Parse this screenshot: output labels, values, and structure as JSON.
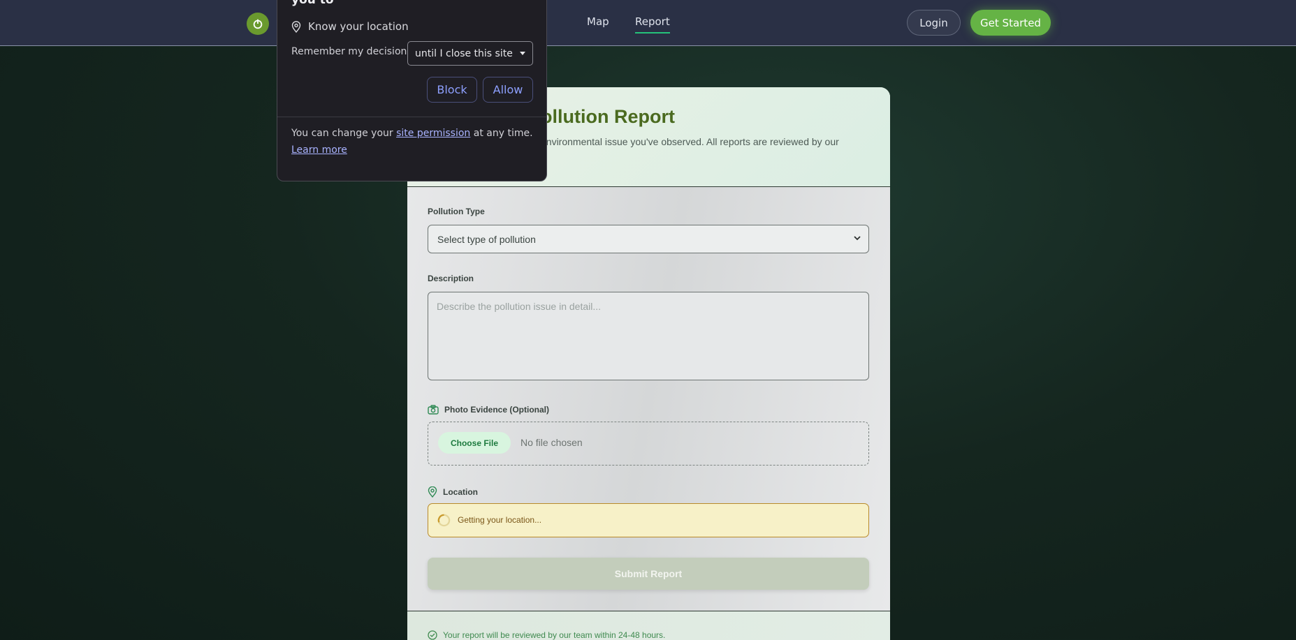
{
  "nav": {
    "links": [
      "Map",
      "Report"
    ],
    "login_label": "Login",
    "cta_label": "Get Started"
  },
  "report": {
    "title": "Pollution Report",
    "title_visible": "ollution Report",
    "subtitle_visible": "environmental issue you've observed. All reports are reviewed by our",
    "pollution_type_label": "Pollution Type",
    "pollution_type_selected": "Select type of pollution",
    "description_label": "Description",
    "description_placeholder": "Describe the pollution issue in detail...",
    "photo_label": "Photo Evidence (Optional)",
    "choose_file_label": "Choose File",
    "no_file_text": "No file chosen",
    "location_label": "Location",
    "location_status": "Getting your location...",
    "submit_label": "Submit Report",
    "footer_note": "Your report will be reviewed by our team within 24-48 hours."
  },
  "permission_popup": {
    "title": "you to",
    "permission_item": "Know your location",
    "remember_label": "Remember my decision",
    "remember_selected": "until I close this site",
    "block_label": "Block",
    "allow_label": "Allow",
    "footer_prefix": "You can change your",
    "footer_link": "site permission",
    "footer_suffix": "at any time.",
    "learn_more": "Learn more"
  },
  "colors": {
    "accent_green": "#65b345",
    "nav_bg": "#2a3045",
    "title_green": "#4a6a1f",
    "warning_bg": "#f7f1c8",
    "popup_bg": "#1f1e24",
    "popup_button_text": "#8ea0ff"
  },
  "icons": {
    "logo": "power-leaf-icon",
    "location_pin": "map-pin-icon",
    "camera": "camera-icon",
    "spinner": "spinner-icon",
    "check": "check-circle-icon"
  }
}
